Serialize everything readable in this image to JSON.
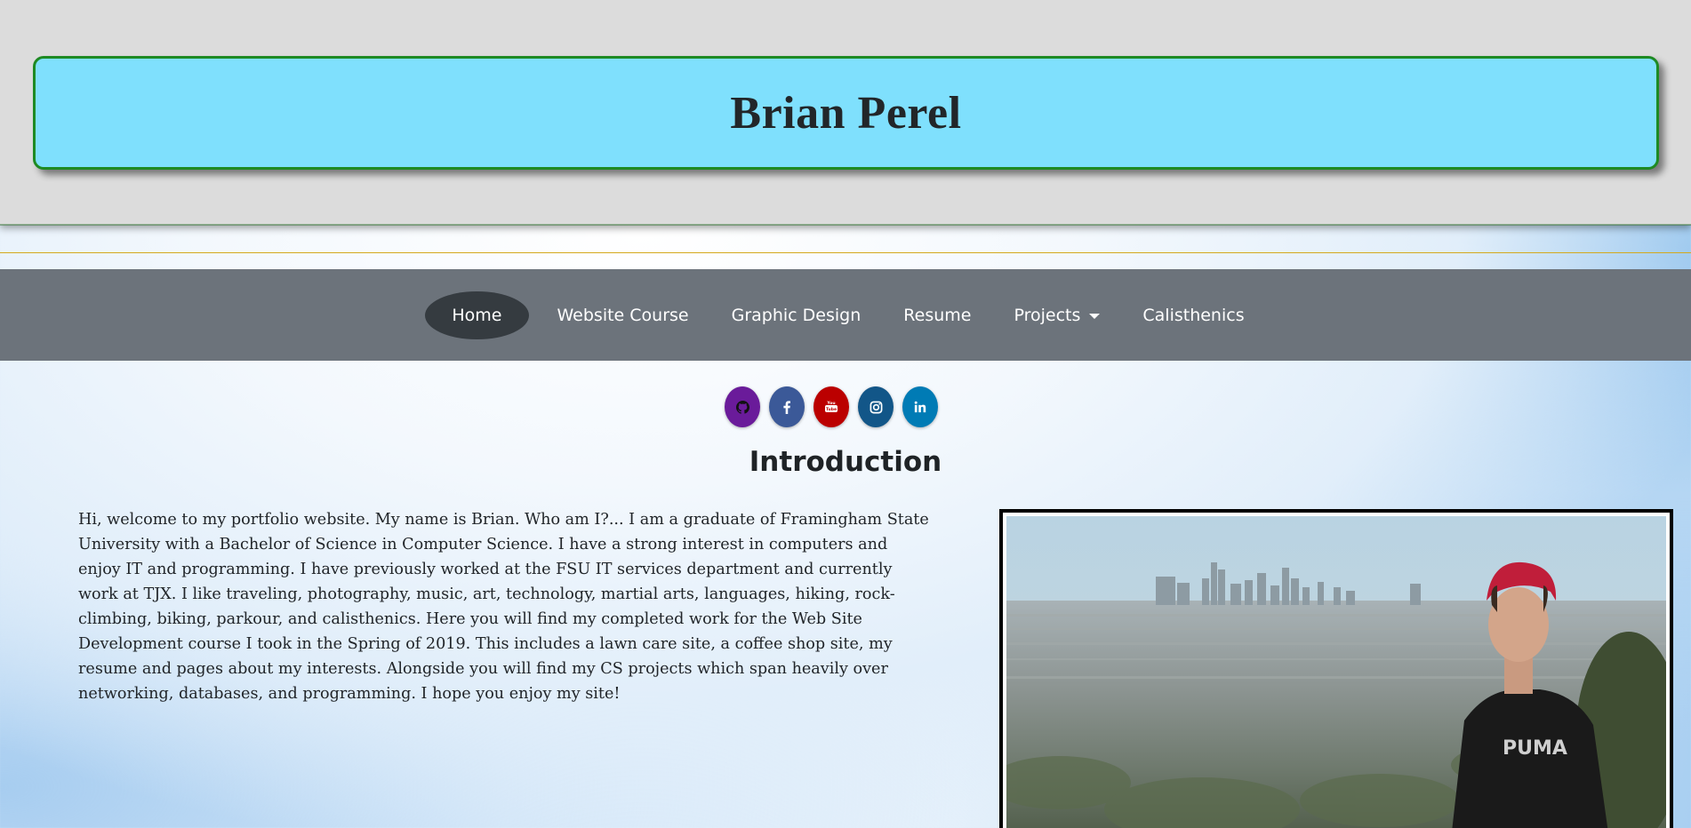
{
  "header": {
    "name": "Brian Perel"
  },
  "nav": {
    "items": [
      {
        "label": "Home",
        "active": true
      },
      {
        "label": "Website Course"
      },
      {
        "label": "Graphic Design"
      },
      {
        "label": "Resume"
      },
      {
        "label": "Projects",
        "dropdown": true
      },
      {
        "label": "Calisthenics"
      }
    ]
  },
  "social": [
    {
      "icon": "github-icon",
      "color": "#6a1b9a"
    },
    {
      "icon": "facebook-icon",
      "color": "#3b5998"
    },
    {
      "icon": "youtube-icon",
      "color": "#bb0000"
    },
    {
      "icon": "instagram-icon",
      "color": "#125688"
    },
    {
      "icon": "linkedin-icon",
      "color": "#007bb5"
    }
  ],
  "intro": {
    "heading": "Introduction",
    "text": "Hi, welcome to my portfolio website. My name is Brian. Who am I?... I am a graduate of Framingham State University with a Bachelor of Science in Computer Science. I have a strong interest in computers and enjoy IT and programming. I have previously worked at the FSU IT services department and currently work at TJX. I like traveling, photography, music, art, technology, martial arts, languages, hiking, rock-climbing, biking, parkour, and calisthenics. Here you will find my completed work for the Web Site Development course I took in the Spring of 2019. This includes a lawn care site, a coffee shop site, my resume and pages about my interests. Alongside you will find my CS projects which span heavily over networking, databases, and programming. I hope you enjoy my site!"
  },
  "photo": {
    "shirt_text": "PUMA"
  }
}
